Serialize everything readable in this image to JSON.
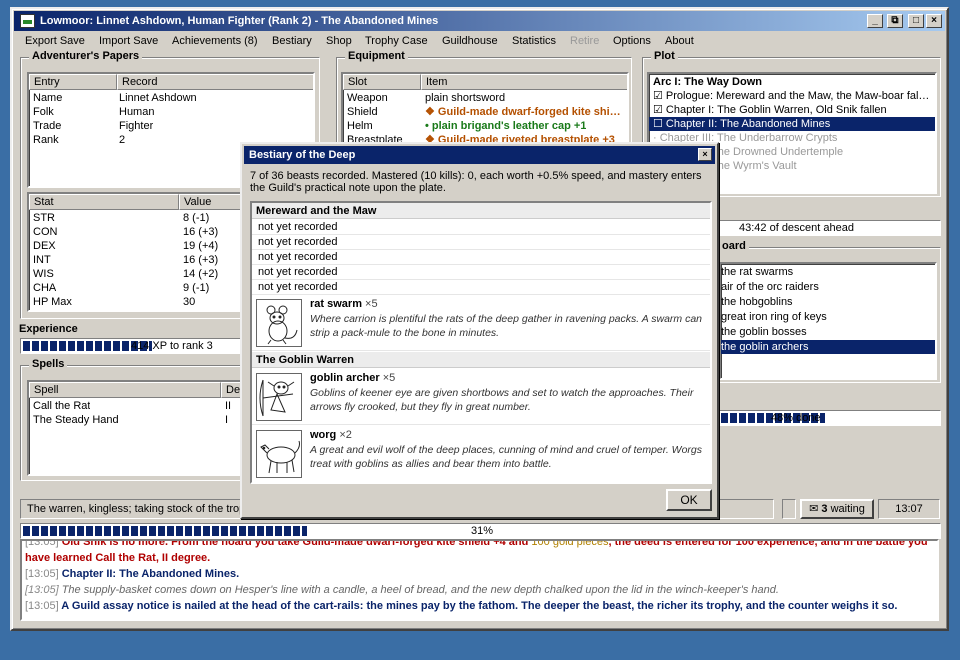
{
  "window": {
    "title": "Lowmoor: Linnet Ashdown, Human Fighter (Rank 2) - The Abandoned Mines",
    "buttons": {
      "minimize": "_",
      "restore": "⧉",
      "maximize": "□",
      "close": "×"
    }
  },
  "menu": [
    "Export Save",
    "Import Save",
    "Achievements (8)",
    "Bestiary",
    "Shop",
    "Trophy Case",
    "Guildhouse",
    "Statistics",
    "Retire",
    "Options",
    "About"
  ],
  "papers": {
    "title": "Adventurer's Papers",
    "headers": [
      "Entry",
      "Record"
    ],
    "rows": [
      [
        "Name",
        "Linnet Ashdown"
      ],
      [
        "Folk",
        "Human"
      ],
      [
        "Trade",
        "Fighter"
      ],
      [
        "Rank",
        "2"
      ]
    ]
  },
  "stats": {
    "headers": [
      "Stat",
      "Value"
    ],
    "rows": [
      [
        "STR",
        "8 (-1)"
      ],
      [
        "CON",
        "16 (+3)"
      ],
      [
        "DEX",
        "19 (+4)"
      ],
      [
        "INT",
        "16 (+3)"
      ],
      [
        "WIS",
        "14 (+2)"
      ],
      [
        "CHA",
        "9 (-1)"
      ],
      [
        "HP Max",
        "30"
      ]
    ]
  },
  "experience": {
    "title": "Experience",
    "bar_text": "414 XP to rank 3",
    "progress": 0.57
  },
  "spells": {
    "title": "Spells",
    "headers": [
      "Spell",
      "De"
    ],
    "rows": [
      [
        "Call the Rat",
        "II"
      ],
      [
        "The Steady Hand",
        "I"
      ]
    ]
  },
  "equipment": {
    "title": "Equipment",
    "headers": [
      "Slot",
      "Item"
    ],
    "rows": [
      [
        "Weapon",
        "plain shortsword"
      ],
      [
        "Shield",
        "❖ Guild-made dwarf-forged kite shi…"
      ],
      [
        "Helm",
        "• plain brigand's leather cap +1"
      ],
      [
        "Breastplate",
        "❖ Guild-made riveted breastplate +3"
      ]
    ]
  },
  "plot": {
    "title": "Plot",
    "items": [
      "Arc I: The Way Down",
      "☑ Prologue: Mereward and the Maw, the Maw-boar fal…",
      "☑ Chapter I: The Goblin Warren, Old Snik fallen",
      "☐ Chapter II: The Abandoned Mines",
      "· Chapter III: The Underbarrow Crypts",
      "The Drowned Undertemple",
      "The Wyrm's Vault"
    ],
    "descent": "43:42 of descent ahead"
  },
  "board": {
    "title": "oard",
    "items": [
      "the rat swarms",
      "air of the orc raiders",
      "the hobgoblins",
      "great iron ring of keys",
      "the goblin bosses",
      "the goblin archers"
    ],
    "bar_text": "48% done",
    "progress": 0.48
  },
  "status": {
    "text": "The warren, kingless; taking stock of the trop",
    "mail_icon": "✉",
    "mail_count": "3",
    "mail_label": "waiting",
    "clock": "13:07"
  },
  "main_progress": {
    "text": "31%",
    "progress": 0.31
  },
  "log": {
    "lines": [
      {
        "ts": "[13:05]",
        "parts": [
          {
            "t": " Old Snik is no more. From the hoard you take Guild-made dwarf-forged kite shield +4 and ",
            "c": "red"
          },
          {
            "t": "100 gold pieces",
            "c": "gold"
          },
          {
            "t": ", the deed is entered for 100 experience, and in the battle you",
            "c": "red"
          }
        ]
      },
      {
        "ts": "",
        "parts": [
          {
            "t": "have learned Call the Rat, II degree.",
            "c": "red"
          }
        ]
      },
      {
        "ts": "[13:05]",
        "parts": [
          {
            "t": " Chapter II: The Abandoned Mines.",
            "c": "blue"
          }
        ]
      },
      {
        "ts": "[13:05]",
        "parts": [
          {
            "t": " The supply-basket comes down on Hesper's line with a candle, a heel of bread, and the new depth chalked upon the lid in the winch-keeper's hand.",
            "c": "it"
          }
        ]
      },
      {
        "ts": "[13:05]",
        "parts": [
          {
            "t": " A Guild assay notice is nailed at the head of the cart-rails: the mines pay by the fathom. The deeper the beast, the richer its trophy, and the counter weighs it so.",
            "c": "blue"
          }
        ]
      }
    ]
  },
  "dialog": {
    "title": "Bestiary of the Deep",
    "close": "×",
    "intro": "7 of 36 beasts recorded. Mastered (10 kills): 0, each worth +0.5% speed, and mastery enters the Guild's practical note upon the plate.",
    "section1": "Mereward and the Maw",
    "unrecorded": [
      "not yet recorded",
      "not yet recorded",
      "not yet recorded",
      "not yet recorded",
      "not yet recorded"
    ],
    "rat": {
      "name": "rat swarm",
      "count": "×5",
      "desc": "Where carrion is plentiful the rats of the deep gather in ravening packs. A swarm can strip a pack-mule to the bone in minutes."
    },
    "section2": "The Goblin Warren",
    "archer": {
      "name": "goblin archer",
      "count": "×5",
      "desc": "Goblins of keener eye are given shortbows and set to watch the approaches. Their arrows fly crooked, but they fly in great number."
    },
    "worg": {
      "name": "worg",
      "count": "×2",
      "desc": "A great and evil wolf of the deep places, cunning of mind and cruel of temper. Worgs treat with goblins as allies and bear them into battle."
    },
    "ok": "OK"
  }
}
